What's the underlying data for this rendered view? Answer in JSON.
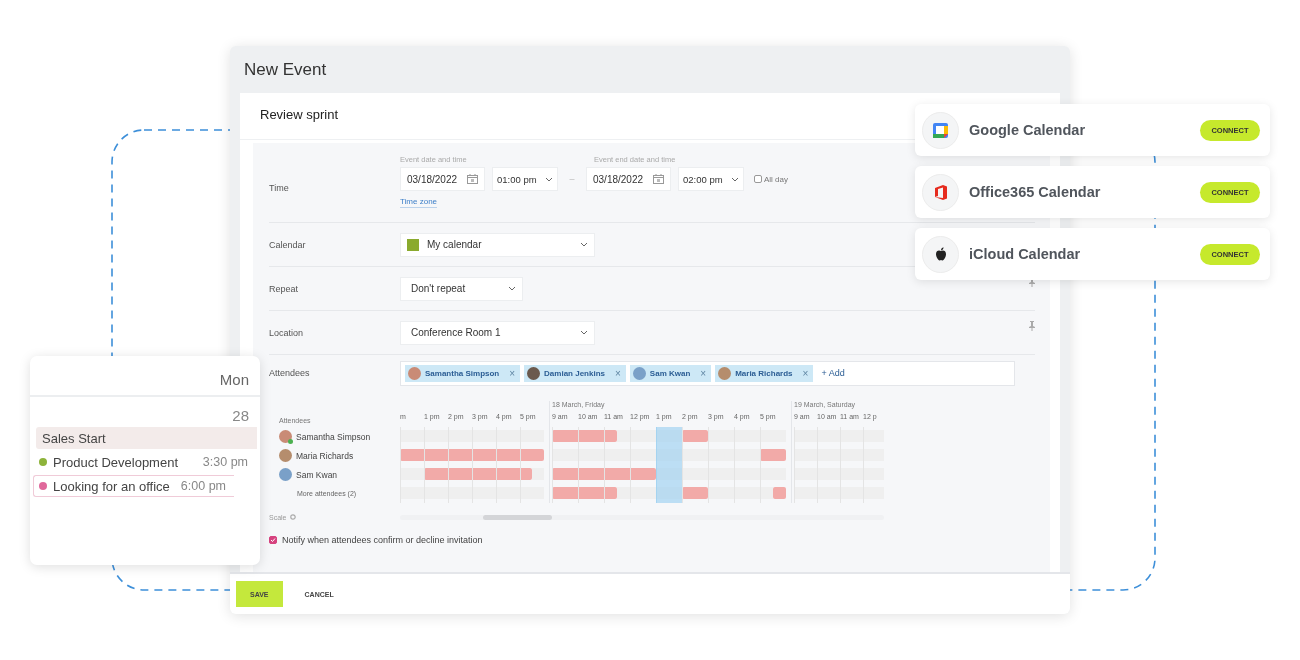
{
  "window": {
    "title": "New Event"
  },
  "event_title": "Review sprint",
  "time": {
    "label": "Time",
    "start_caption": "Event date and time",
    "start_date": "03/18/2022",
    "start_time": "01:00 pm",
    "separator": "–",
    "end_caption": "Event end date and time",
    "end_date": "03/18/2022",
    "end_time": "02:00 pm",
    "all_day": {
      "label": "All day",
      "checked": false
    },
    "time_zone_link": "Time zone"
  },
  "calendar": {
    "label": "Calendar",
    "value": "My calendar"
  },
  "repeat": {
    "label": "Repeat",
    "value": "Don't repeat"
  },
  "location": {
    "label": "Location",
    "value": "Conference Room 1"
  },
  "attendees": {
    "label": "Attendees",
    "chips": [
      {
        "name": "Samantha Simpson",
        "remove": "×"
      },
      {
        "name": "Damian Jenkins",
        "remove": "×"
      },
      {
        "name": "Sam Kwan",
        "remove": "×"
      },
      {
        "name": "Maria Richards",
        "remove": "×"
      }
    ],
    "add_link": "+ Add"
  },
  "schedule": {
    "label": "Attendees",
    "days": [
      {
        "hours": [
          {
            "label": "m",
            "selected": false
          },
          {
            "label": "1 pm",
            "selected": false
          },
          {
            "label": "2 pm",
            "selected": false
          },
          {
            "label": "3 pm",
            "selected": false
          },
          {
            "label": "4 pm",
            "selected": false
          },
          {
            "label": "5 pm",
            "selected": false
          }
        ]
      },
      {
        "title": "18 March, Friday",
        "hours": [
          {
            "label": "9 am",
            "selected": false
          },
          {
            "label": "10 am",
            "selected": false
          },
          {
            "label": "11 am",
            "selected": false
          },
          {
            "label": "12 pm",
            "selected": false
          },
          {
            "label": "1 pm",
            "selected": true
          },
          {
            "label": "2 pm",
            "selected": false
          },
          {
            "label": "3 pm",
            "selected": false
          },
          {
            "label": "4 pm",
            "selected": false
          },
          {
            "label": "5 pm",
            "selected": false
          }
        ]
      },
      {
        "title": "19 March, Saturday",
        "hours": [
          {
            "label": "9 am",
            "selected": false
          },
          {
            "label": "10 am",
            "selected": false
          },
          {
            "label": "11 am",
            "selected": false
          },
          {
            "label": "12 p",
            "selected": false
          }
        ]
      }
    ],
    "people": [
      {
        "kind": "person",
        "name": "Samantha Simpson",
        "online": true,
        "busy": [
          [
            false,
            false,
            false,
            false,
            false,
            false,
            false,
            false,
            false,
            false,
            false,
            false
          ],
          [
            true,
            true,
            true,
            true,
            true,
            false,
            false,
            false,
            false,
            false,
            true,
            true,
            false,
            false,
            false,
            false,
            false,
            false
          ],
          [
            false,
            false,
            false,
            false,
            false,
            false,
            false,
            false
          ]
        ]
      },
      {
        "kind": "person",
        "name": "Maria Richards",
        "online": false,
        "busy": [
          [
            true,
            true,
            true,
            true,
            true,
            true,
            true,
            true,
            true,
            true,
            true,
            true
          ],
          [
            false,
            false,
            false,
            false,
            false,
            false,
            false,
            false,
            false,
            false,
            false,
            false,
            false,
            false,
            false,
            false,
            true,
            true
          ],
          [
            false,
            false,
            false,
            false,
            false,
            false,
            false,
            false
          ]
        ]
      },
      {
        "kind": "person",
        "name": "Sam Kwan",
        "online": false,
        "busy": [
          [
            false,
            false,
            true,
            true,
            true,
            true,
            true,
            true,
            true,
            true,
            true,
            false
          ],
          [
            true,
            true,
            true,
            true,
            true,
            true,
            true,
            true,
            false,
            false,
            false,
            false,
            false,
            false,
            false,
            false,
            false,
            false
          ],
          [
            false,
            false,
            false,
            false,
            false,
            false,
            false,
            false
          ]
        ]
      },
      {
        "kind": "more",
        "name": "More attendees (2)",
        "busy": [
          [
            false,
            false,
            false,
            false,
            false,
            false,
            false,
            false,
            false,
            false,
            false,
            false
          ],
          [
            true,
            true,
            true,
            true,
            true,
            false,
            false,
            false,
            false,
            false,
            true,
            true,
            false,
            false,
            false,
            false,
            false,
            true
          ],
          [
            false,
            false,
            false,
            false,
            false,
            false,
            false,
            false
          ]
        ]
      }
    ],
    "scale_label": "Scale"
  },
  "notify": {
    "label": "Notify when attendees confirm or decline invitation",
    "checked": true
  },
  "footer": {
    "buttons": [
      {
        "kind": "primary",
        "label": "SAVE"
      },
      {
        "kind": "plain",
        "label": "CANCEL"
      }
    ]
  },
  "integrations": [
    {
      "kind": "google",
      "name": "Google Calendar",
      "button": "CONNECT"
    },
    {
      "kind": "office",
      "name": "Office365 Calendar",
      "button": "CONNECT"
    },
    {
      "kind": "apple",
      "name": "iCloud Calendar",
      "button": "CONNECT"
    }
  ],
  "day_card": {
    "weekday": "Mon",
    "date": "28",
    "events": [
      {
        "kind": "allday",
        "title": "Sales Start",
        "selected": false
      },
      {
        "kind": "timed",
        "title": "Product Development",
        "time": "3:30 pm",
        "color": "#8db33a",
        "selected": false
      },
      {
        "kind": "timed",
        "title": "Looking for an office",
        "time": "6:00 pm",
        "color": "#e0689b",
        "selected": true
      }
    ]
  }
}
